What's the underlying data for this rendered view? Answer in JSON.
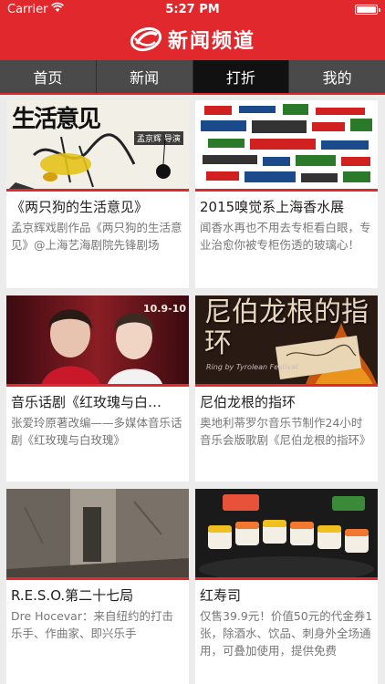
{
  "status_bar": {
    "carrier": "Carrier",
    "time": "5:27 PM"
  },
  "header": {
    "title": "新闻频道"
  },
  "tabs": [
    {
      "label": "首页",
      "active": false
    },
    {
      "label": "新闻",
      "active": false
    },
    {
      "label": "打折",
      "active": true
    },
    {
      "label": "我的",
      "active": false
    }
  ],
  "cards": [
    {
      "title": "《两只狗的生活意见》",
      "description": "孟京辉戏剧作品《两只狗的生活意见》@上海艺海剧院先锋剧场",
      "image_text": {
        "big": "生活意见",
        "credit": "孟京辉 导演"
      }
    },
    {
      "title": "2015嗅觉系上海香水展",
      "description": "闻香水再也不用去专柜看白眼，专业治愈你被专柜伤透的玻璃心！",
      "image_text": {}
    },
    {
      "title": "音乐话剧《红玫瑰与白…",
      "description": "张爱玲原著改编——多媒体音乐话剧《红玫瑰与白玫瑰》",
      "image_text": {
        "date": "10.9-10"
      }
    },
    {
      "title": "尼伯龙根的指环",
      "description": "奥地利蒂罗尔音乐节制作24小时音乐会版歌剧《尼伯龙根的指环》",
      "image_text": {
        "big": "尼伯龙根的指环",
        "sub": "Ring by Tyrolean Festival"
      }
    },
    {
      "title": "R.E.S.O.第二十七局",
      "description": "Dre Hocevar：来自纽约的打击乐手、作曲家、即兴乐手",
      "image_text": {}
    },
    {
      "title": "红寿司",
      "description": "仅售39.9元！价值50元的代金券1张，除酒水、饮品、刺身外全场通用，可叠加使用，提供免费",
      "image_text": {}
    }
  ],
  "colors": {
    "brand_red": "#e0282d",
    "tab_bg": "#4a4a4a",
    "tab_active_bg": "#111111",
    "page_bg": "#ececec"
  }
}
